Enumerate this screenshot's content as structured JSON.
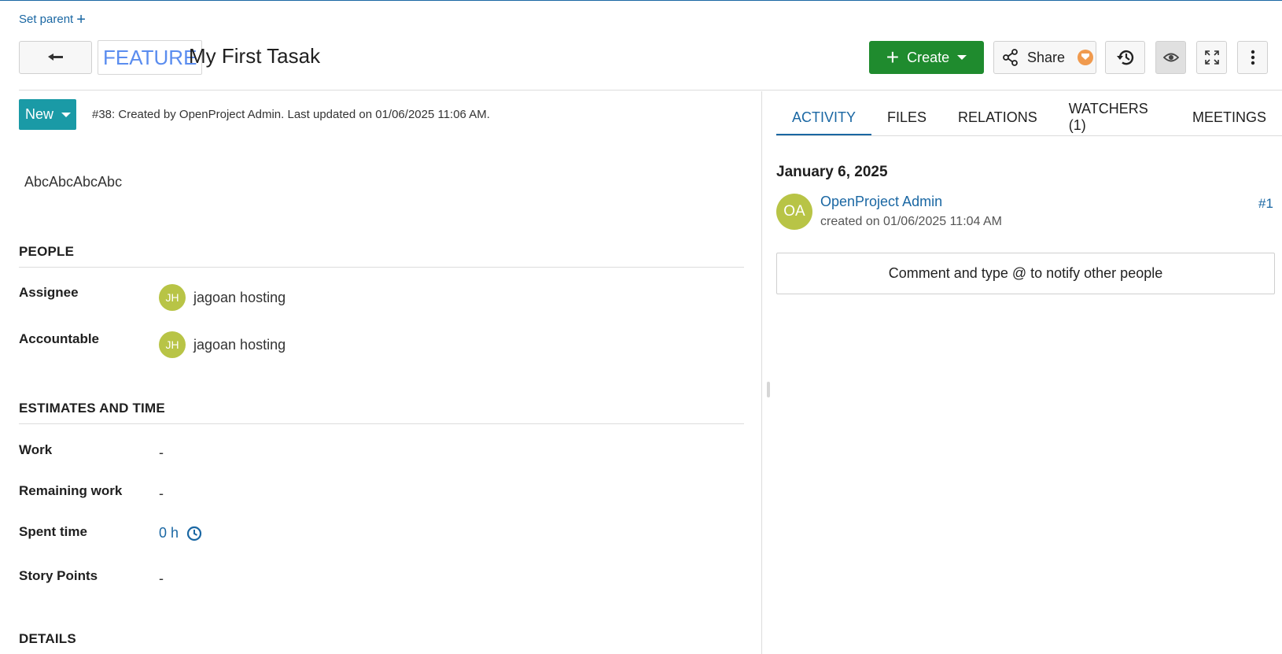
{
  "header": {
    "set_parent": "Set parent",
    "type": "FEATURE",
    "subject": "My First Tasak",
    "create_label": "Create",
    "share_label": "Share"
  },
  "status": {
    "label": "New",
    "meta": "#38: Created by OpenProject Admin. Last updated on 01/06/2025 11:06 AM."
  },
  "description": "AbcAbcAbcAbc",
  "people": {
    "title": "PEOPLE",
    "assignee_label": "Assignee",
    "assignee_initials": "JH",
    "assignee_name": "jagoan hosting",
    "accountable_label": "Accountable",
    "accountable_initials": "JH",
    "accountable_name": "jagoan hosting"
  },
  "estimates": {
    "title": "ESTIMATES AND TIME",
    "work_label": "Work",
    "work_value": "-",
    "remaining_label": "Remaining work",
    "remaining_value": "-",
    "spent_label": "Spent time",
    "spent_value": "0 h",
    "story_label": "Story Points",
    "story_value": "-"
  },
  "details": {
    "title": "DETAILS"
  },
  "tabs": [
    "ACTIVITY",
    "FILES",
    "RELATIONS",
    "WATCHERS (1)",
    "MEETINGS"
  ],
  "activity": {
    "date": "January 6, 2025",
    "initials": "OA",
    "user": "OpenProject Admin",
    "created": "created on 01/06/2025 11:04 AM",
    "number": "#1",
    "comment_placeholder": "Comment and type @ to notify other people"
  },
  "icons": {
    "back": "back-arrow-icon",
    "create_plus": "plus-icon",
    "share": "share-icon",
    "history": "history-icon",
    "watch": "eye-icon",
    "fullscreen": "fullscreen-icon",
    "more": "more-vertical-icon",
    "spent_clock": "clock-icon"
  },
  "colors": {
    "accent": "#1a67a3",
    "create": "#1f8b2e",
    "status": "#1a9aa6",
    "avatar": "#b8c446",
    "type": "#5b8def"
  }
}
